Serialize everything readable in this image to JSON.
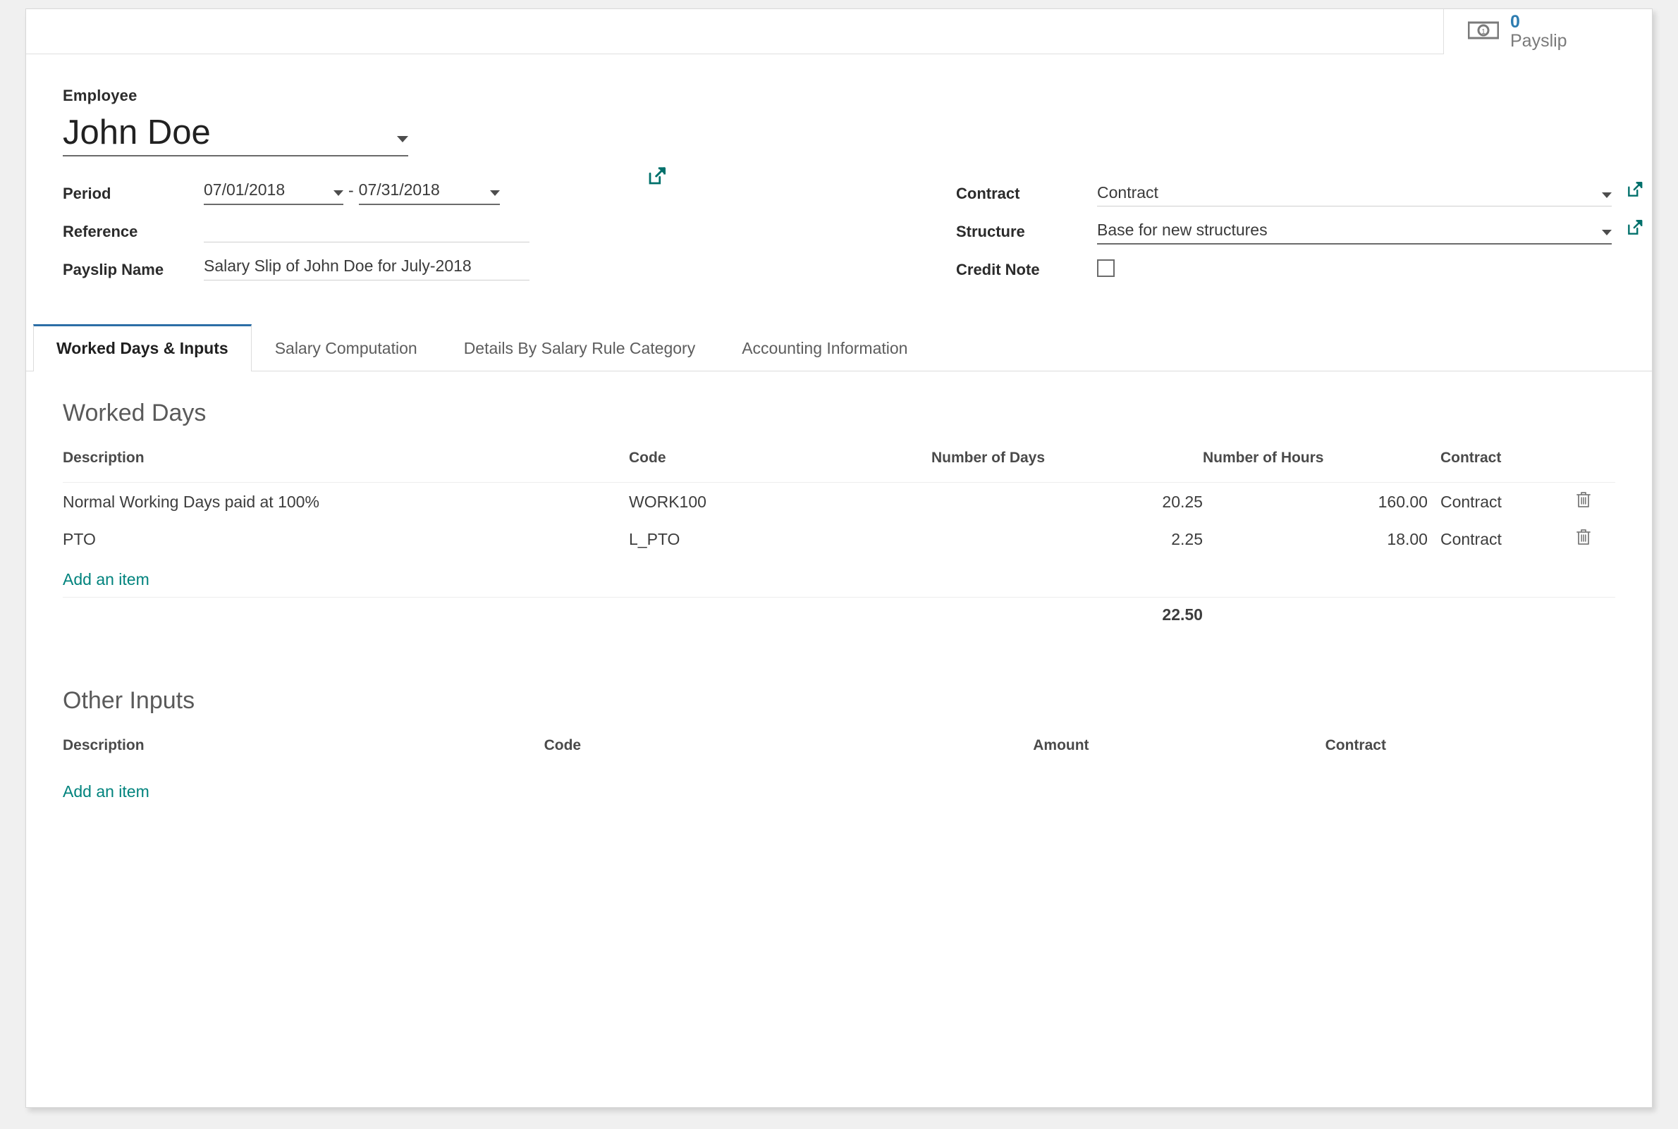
{
  "stat_button": {
    "icon": "banknote-icon",
    "value": "0",
    "label": "Payslip"
  },
  "form": {
    "employee_label": "Employee",
    "employee_value": "John Doe",
    "left_fields": {
      "period_label": "Period",
      "period_from": "07/01/2018",
      "period_separator": "-",
      "period_to": "07/31/2018",
      "reference_label": "Reference",
      "reference_value": "",
      "payslip_name_label": "Payslip Name",
      "payslip_name_value": "Salary Slip of John Doe for July-2018"
    },
    "right_fields": {
      "contract_label": "Contract",
      "contract_value": "Contract",
      "structure_label": "Structure",
      "structure_value": "Base for new structures",
      "credit_note_label": "Credit Note",
      "credit_note_checked": false
    }
  },
  "tabs": [
    {
      "label": "Worked Days & Inputs",
      "active": true
    },
    {
      "label": "Salary Computation",
      "active": false
    },
    {
      "label": "Details By Salary Rule Category",
      "active": false
    },
    {
      "label": "Accounting Information",
      "active": false
    }
  ],
  "worked_days": {
    "title": "Worked Days",
    "headers": {
      "description": "Description",
      "code": "Code",
      "number_of_days": "Number of Days",
      "number_of_hours": "Number of Hours",
      "contract": "Contract"
    },
    "rows": [
      {
        "description": "Normal Working Days paid at 100%",
        "code": "WORK100",
        "number_of_days": "20.25",
        "number_of_hours": "160.00",
        "contract": "Contract",
        "highlighted": false
      },
      {
        "description": "PTO",
        "code": "L_PTO",
        "number_of_days": "2.25",
        "number_of_hours": "18.00",
        "contract": "Contract",
        "highlighted": true
      }
    ],
    "add_item_label": "Add an item",
    "total_days": "22.50"
  },
  "other_inputs": {
    "title": "Other Inputs",
    "headers": {
      "description": "Description",
      "code": "Code",
      "amount": "Amount",
      "contract": "Contract"
    },
    "rows": [],
    "add_item_label": "Add an item"
  },
  "colors": {
    "accent_teal": "#00837d",
    "stat_blue": "#2d7cb0",
    "highlight_pink": "#e8557e",
    "active_tab_blue": "#2c6ea6"
  }
}
